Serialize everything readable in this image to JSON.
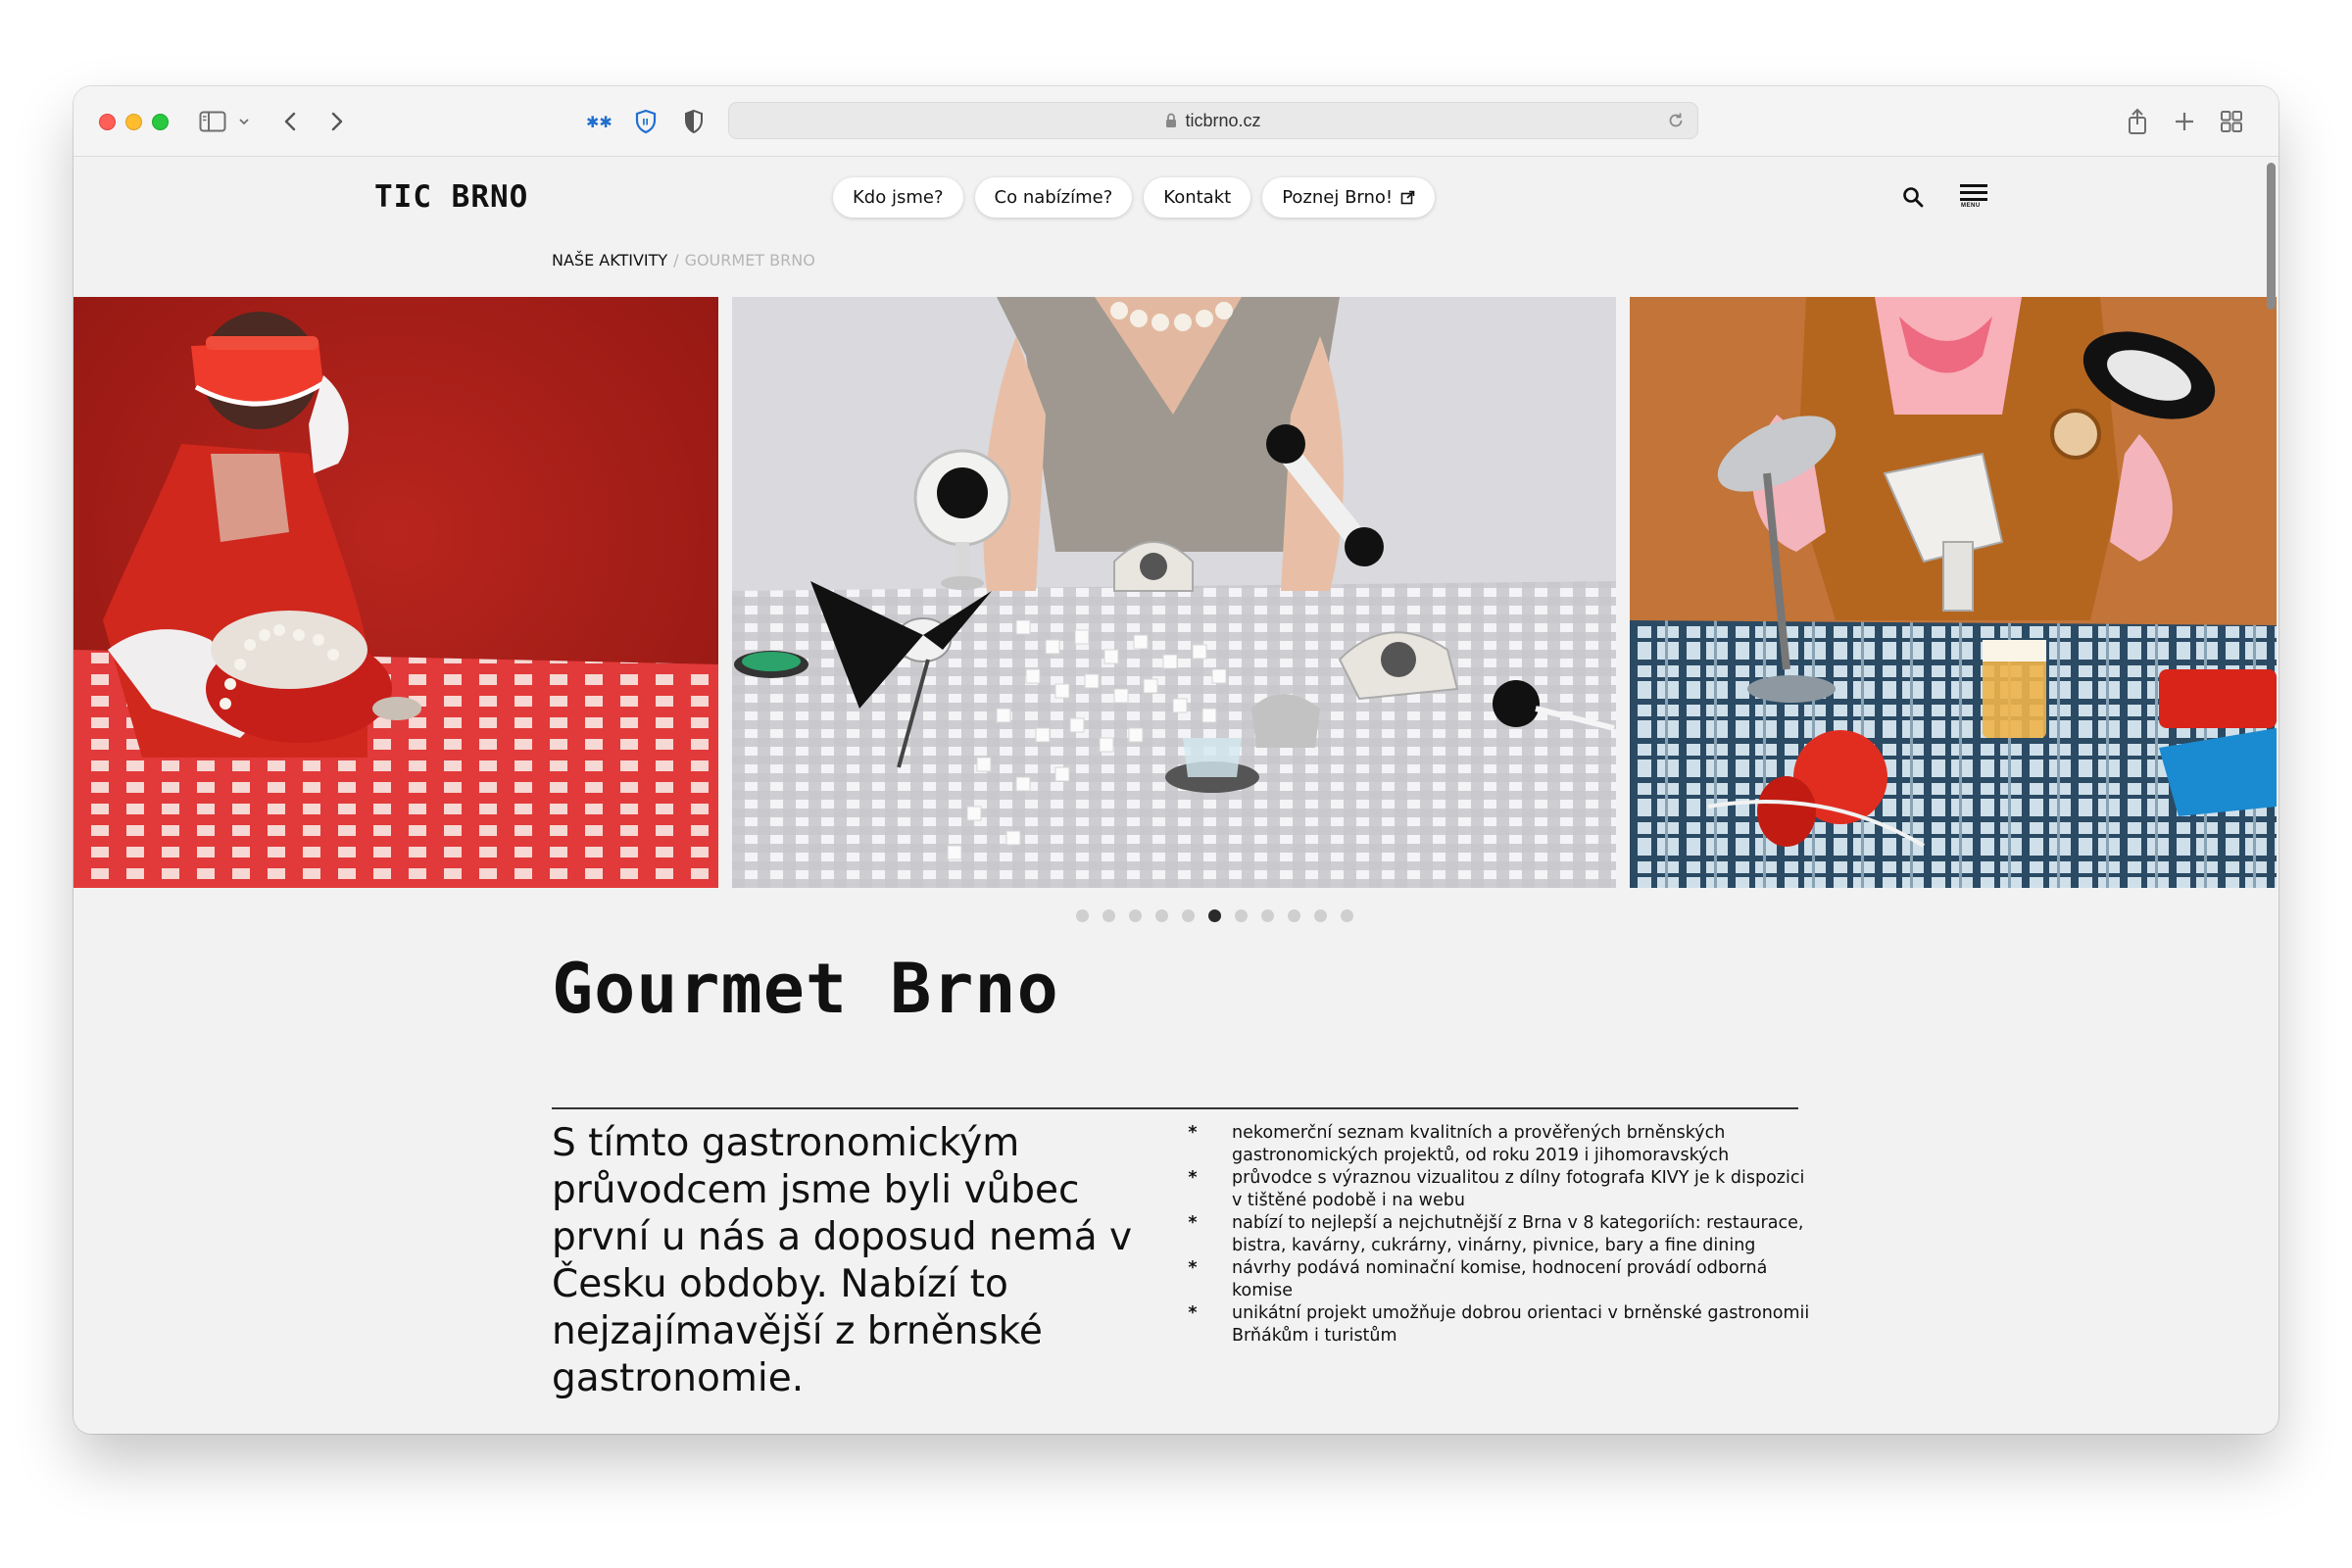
{
  "browser": {
    "url": "ticbrno.cz"
  },
  "site": {
    "logo": "TIC BRNO",
    "nav": [
      {
        "label": "Kdo jsme?"
      },
      {
        "label": "Co nabízíme?"
      },
      {
        "label": "Kontakt"
      },
      {
        "label": "Poznej Brno!",
        "icon": "external-link-icon"
      }
    ],
    "menu_label": "MENU"
  },
  "breadcrumb": {
    "items": [
      "NAŠE AKTIVITY",
      "GOURMET BRNO"
    ],
    "separator": "/"
  },
  "gallery": {
    "photos": [
      {
        "name": "woman-red-visor-pearls-red-checked-table"
      },
      {
        "name": "woman-grey-dress-telephones-sugar-cubes"
      },
      {
        "name": "woman-hair-dryer-beer-plaid-table"
      }
    ],
    "dot_count": 11,
    "active_index": 5
  },
  "article": {
    "title": "Gourmet Brno",
    "lead": "S tímto gastronomickým průvodcem jsme byli vůbec první u nás a doposud nemá v Česku obdoby. Nabízí to nejzajímavější z brněnské gastronomie.",
    "bullet_char": "*",
    "facts": [
      "nekomerční seznam kvalitních a prověřených brněnských gastronomických projektů, od roku 2019 i jihomoravských",
      "průvodce s výraznou vizualitou z dílny fotografa KIVY je k dispozici v tištěné podobě i na webu",
      "nabízí to nejlepší a nejchutnější z Brna v 8 kategoriích: restaurace, bistra, kavárny, cukrárny, vinárny, pivnice, bary a fine dining",
      "návrhy podává nominační komise, hodnocení provádí odborná komise",
      "unikátní projekt umožňuje dobrou orientaci v brněnské gastronomii Brňákům i turistům"
    ]
  },
  "colors": {
    "page_bg": "#f2f2f2",
    "text": "#111111",
    "breadcrumb_inactive": "#b5b5b5",
    "active_dot": "#2a2a2a",
    "inactive_dot": "#cfcfcf"
  }
}
